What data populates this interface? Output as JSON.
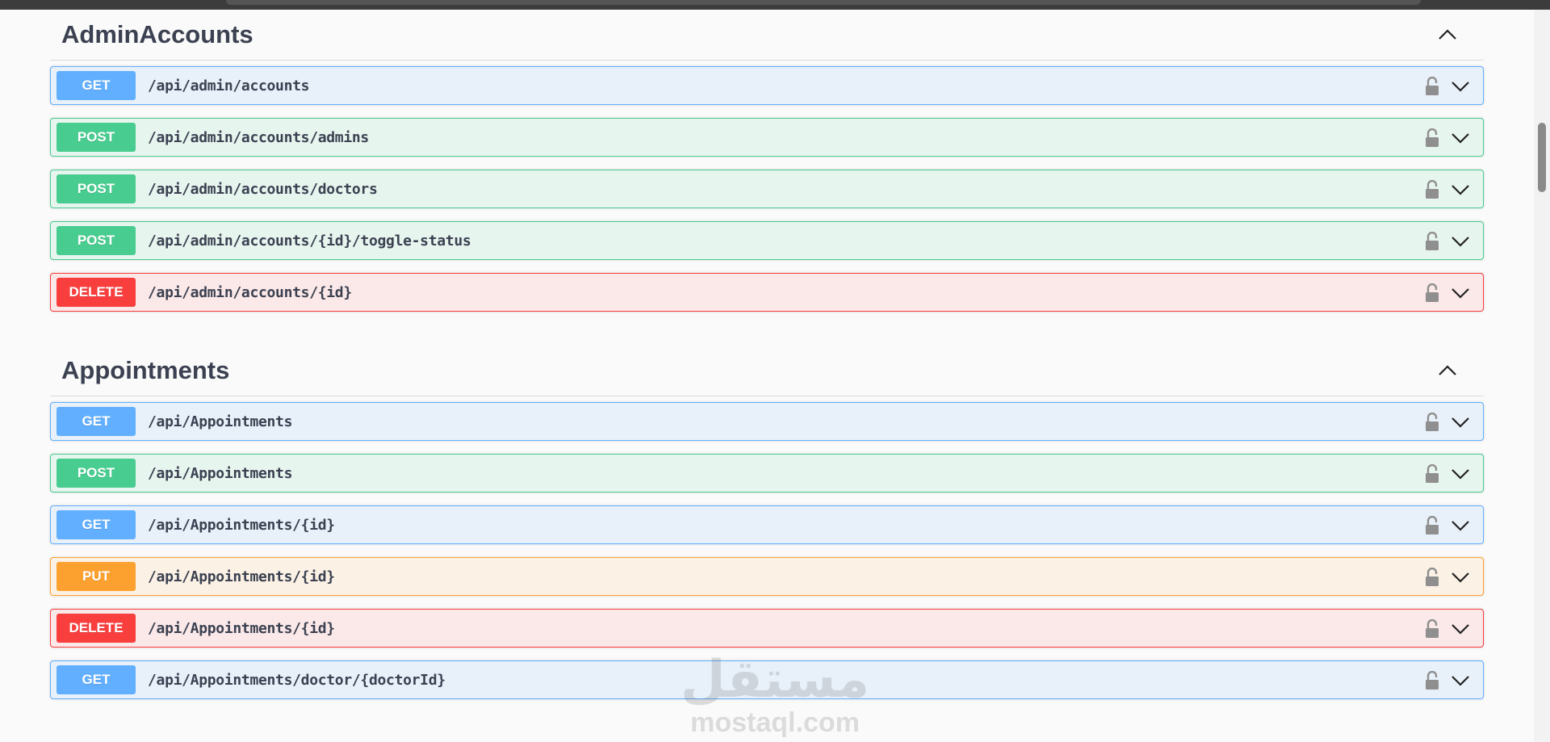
{
  "sections": [
    {
      "title": "AdminAccounts",
      "expanded": true,
      "operations": [
        {
          "method": "GET",
          "path": "/api/admin/accounts"
        },
        {
          "method": "POST",
          "path": "/api/admin/accounts/admins"
        },
        {
          "method": "POST",
          "path": "/api/admin/accounts/doctors"
        },
        {
          "method": "POST",
          "path": "/api/admin/accounts/{id}/toggle-status"
        },
        {
          "method": "DELETE",
          "path": "/api/admin/accounts/{id}"
        }
      ]
    },
    {
      "title": "Appointments",
      "expanded": true,
      "operations": [
        {
          "method": "GET",
          "path": "/api/Appointments"
        },
        {
          "method": "POST",
          "path": "/api/Appointments"
        },
        {
          "method": "GET",
          "path": "/api/Appointments/{id}"
        },
        {
          "method": "PUT",
          "path": "/api/Appointments/{id}"
        },
        {
          "method": "DELETE",
          "path": "/api/Appointments/{id}"
        },
        {
          "method": "GET",
          "path": "/api/Appointments/doctor/{doctorId}"
        }
      ]
    }
  ],
  "icons": {
    "lock": "lock-icon",
    "expand": "chevron-down-icon",
    "collapse": "chevron-up-icon"
  },
  "colors": {
    "get": "#61affe",
    "post": "#49cc90",
    "delete": "#f93e3e",
    "put": "#fca130"
  },
  "watermark": {
    "arabic": "مستقل",
    "latin": "mostaql.com"
  }
}
